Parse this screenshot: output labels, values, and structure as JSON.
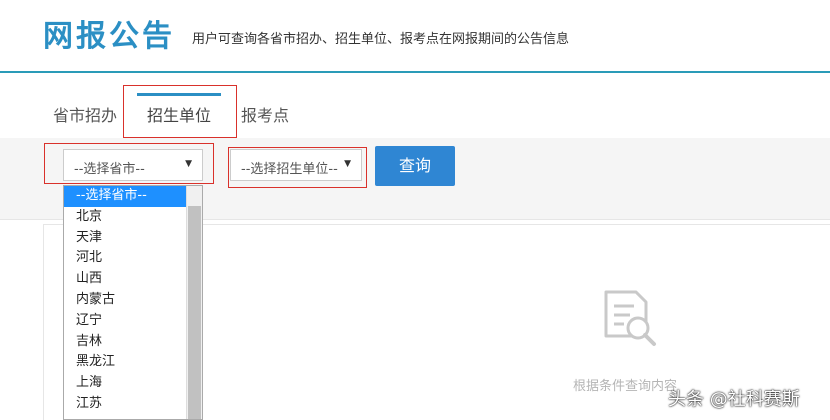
{
  "header": {
    "title": "网报公告",
    "subtitle": "用户可查询各省市招办、招生单位、报考点在网报期间的公告信息"
  },
  "tabs": [
    {
      "label": "省市招办",
      "active": false
    },
    {
      "label": "招生单位",
      "active": true
    },
    {
      "label": "报考点",
      "active": false
    }
  ],
  "filters": {
    "province_select": "--选择省市--",
    "unit_select": "--选择招生单位--",
    "query_button": "查询"
  },
  "province_dropdown": {
    "options": [
      "--选择省市--",
      "北京",
      "天津",
      "河北",
      "山西",
      "内蒙古",
      "辽宁",
      "吉林",
      "黑龙江",
      "上海",
      "江苏"
    ],
    "selected_index": 0
  },
  "empty_state": {
    "icon": "document-search-icon",
    "text": "根据条件查询内容"
  },
  "watermark": "头条 @社科赛斯",
  "colors": {
    "brand": "#2b8fc4",
    "button": "#2f86d3",
    "highlight": "#d9312b",
    "selected_option": "#1e90ff"
  }
}
